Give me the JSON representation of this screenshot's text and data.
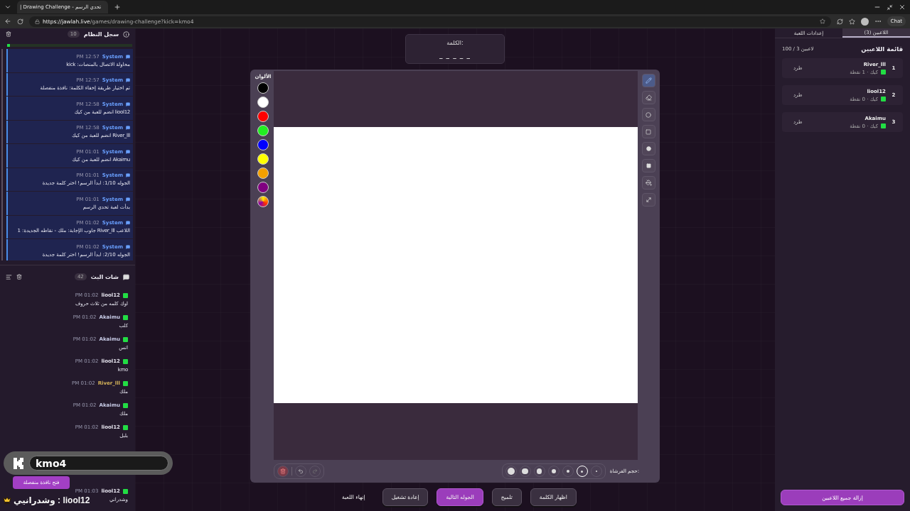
{
  "browser": {
    "tab_title": "| Drawing Challenge - تحدي الرسم",
    "url_host": "https://jawlah.live",
    "url_path": "/games/drawing-challenge?kick=kmo4",
    "chat_label": "Chat"
  },
  "system_log": {
    "title": "سجل النظام",
    "count": "10",
    "progress": {
      "level": 0.02
    },
    "entries": [
      {
        "sender": "System",
        "time": "PM 12:57",
        "text": "محاولة الاتصال بالمنصات: kick"
      },
      {
        "sender": "System",
        "time": "PM 12:57",
        "text": "تم اختيار طريقة إخفاء الكلمة: نافذة منفصلة"
      },
      {
        "sender": "System",
        "time": "PM 12:58",
        "text": "liool12 انضم للعبة من كيك"
      },
      {
        "sender": "System",
        "time": "PM 12:58",
        "text": "River_lll انضم للعبة من كيك"
      },
      {
        "sender": "System",
        "time": "PM 01:01",
        "text": "Akaimu انضم للعبة من كيك"
      },
      {
        "sender": "System",
        "time": "PM 01:01",
        "text": "الجوله 1/10: ابدأ الرسم! اختر كلمة جديدة"
      },
      {
        "sender": "System",
        "time": "PM 01:01",
        "text": "بدأت لعبة تحدي الرسم"
      },
      {
        "sender": "System",
        "time": "PM 01:02",
        "text": "اللاعب River_lll جاوب الإجابة: ملك - نقاطه الجديدة: 1"
      },
      {
        "sender": "System",
        "time": "PM 01:02",
        "text": "الجوله 2/10: ابدأ الرسم! اختر كلمة جديدة"
      }
    ]
  },
  "chat": {
    "title": "شات البث",
    "count": "42",
    "messages": [
      {
        "user": "liool12",
        "time": "PM 01:02",
        "text": "اوك كلمه من ثلاث حروف",
        "color": "#e4e2ec"
      },
      {
        "user": "Akaimu",
        "time": "PM 01:02",
        "text": "كلب",
        "color": "#c9cde8"
      },
      {
        "user": "Akaimu",
        "time": "PM 01:02",
        "text": "انس",
        "color": "#c9cde8"
      },
      {
        "user": "liool12",
        "time": "PM 01:02",
        "text": "kmo",
        "color": "#e4e2ec"
      },
      {
        "user": "River_lll",
        "time": "PM 01:02",
        "text": "ملك",
        "color": "#d6b45a"
      },
      {
        "user": "Akaimu",
        "time": "PM 01:02",
        "text": "ملك",
        "color": "#c9cde8"
      },
      {
        "user": "liool12",
        "time": "PM 01:02",
        "text": "بلبل",
        "color": "#e4e2ec"
      },
      {
        "user": "liool12",
        "time": "PM 01:03",
        "text": "وشدراني",
        "color": "#e4e2ec"
      }
    ]
  },
  "overlay": {
    "channel": "kmo4",
    "open_window_button": "فتح نافذة منفصلة",
    "message": "liool12 : وشدرانيي"
  },
  "word": {
    "label": "الكلمة:",
    "mask": "_ _ _ _ _"
  },
  "canvas": {
    "colors_label": "الألوان",
    "colors": [
      {
        "kind": "solid",
        "color": "#000000"
      },
      {
        "kind": "solid",
        "color": "#ffffff"
      },
      {
        "kind": "solid",
        "color": "#ff0000"
      },
      {
        "kind": "solid",
        "color": "#22ee22"
      },
      {
        "kind": "solid",
        "color": "#0000ff"
      },
      {
        "kind": "solid",
        "color": "#ffff00"
      },
      {
        "kind": "solid",
        "color": "#f5a000"
      },
      {
        "kind": "solid",
        "color": "#800080"
      },
      {
        "kind": "custom"
      }
    ],
    "tools": [
      {
        "kind": "pen",
        "selected": true
      },
      {
        "kind": "eraser",
        "selected": false
      },
      {
        "kind": "circle",
        "selected": false
      },
      {
        "kind": "rect",
        "selected": false
      },
      {
        "kind": "filled-circle",
        "selected": false
      },
      {
        "kind": "filled-rect",
        "selected": false
      },
      {
        "kind": "fill",
        "selected": false
      },
      {
        "kind": "line",
        "selected": false
      }
    ],
    "brush_label": "حجم الفرشاة:",
    "brush_sizes": [
      {
        "selected": false
      },
      {
        "selected": false
      },
      {
        "selected": false
      },
      {
        "selected": false
      },
      {
        "selected": false
      },
      {
        "selected": true
      },
      {
        "selected": false
      }
    ]
  },
  "controls": [
    {
      "label": "اظهار الكلمة",
      "kind": "plain"
    },
    {
      "label": "تلميح",
      "kind": "plain"
    },
    {
      "label": "الجوله التالية",
      "kind": "primary"
    },
    {
      "label": "إعادة تشغيل",
      "kind": "plain"
    },
    {
      "label": "إنهاء اللعبة",
      "kind": "text"
    }
  ],
  "players_panel": {
    "tabs": [
      {
        "label": "اللاعبين (3)",
        "selected": true
      },
      {
        "label": "إعدادات اللعبة",
        "selected": false
      }
    ],
    "title": "قائمة اللاعبين",
    "count": "100 / 3 لاعبين",
    "players": [
      {
        "rank": "1",
        "name": "River_lll",
        "meta": "كيك · 1 نقطة",
        "kick_label": "طرد"
      },
      {
        "rank": "2",
        "name": "liool12",
        "meta": "كيك · 0 نقطة",
        "kick_label": "طرد"
      },
      {
        "rank": "3",
        "name": "Akaimu",
        "meta": "كيك · 0 نقطة",
        "kick_label": "طرد"
      }
    ],
    "remove_all": "إزالة جميع اللاعبين"
  }
}
